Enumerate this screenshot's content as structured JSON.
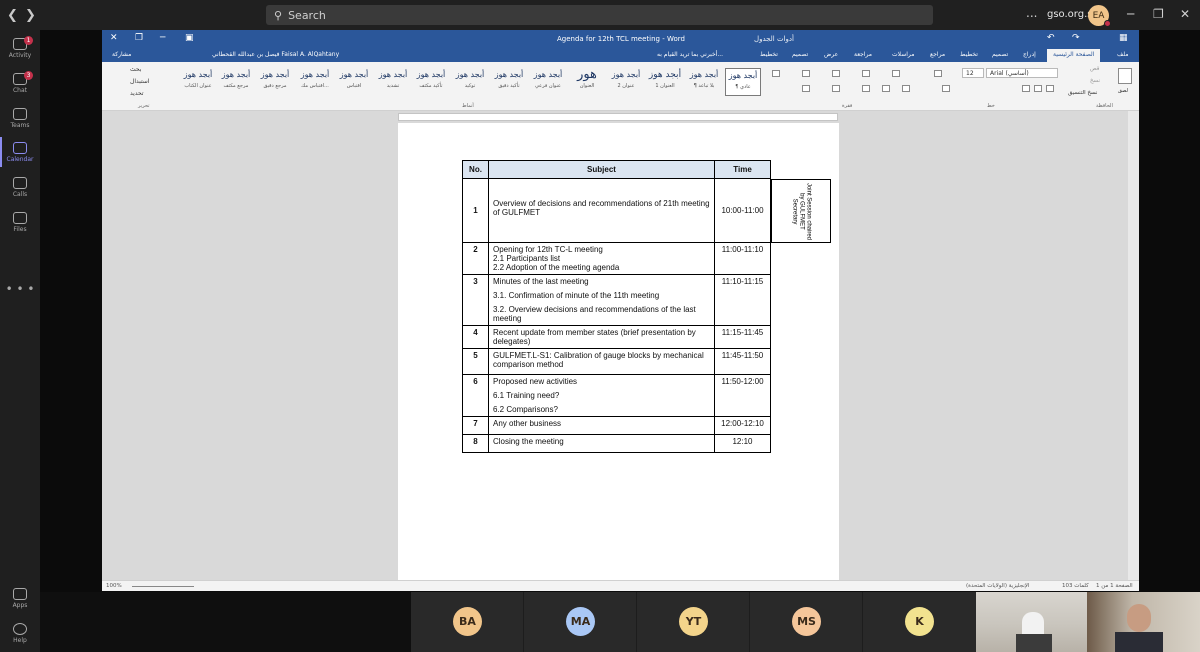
{
  "teams": {
    "search_placeholder": "Search",
    "org": "gso.org.sa",
    "user_initials": "EA",
    "rail": [
      {
        "label": "Activity",
        "badge": "1"
      },
      {
        "label": "Chat",
        "badge": "3"
      },
      {
        "label": "Teams",
        "badge": ""
      },
      {
        "label": "Calendar",
        "badge": ""
      },
      {
        "label": "Calls",
        "badge": ""
      },
      {
        "label": "Files",
        "badge": ""
      },
      {
        "label": "Apps",
        "badge": ""
      },
      {
        "label": "Help",
        "badge": ""
      }
    ],
    "more": "..."
  },
  "word": {
    "title": "Agenda for 12th TCL meeting - Word",
    "table_tools": "أدوات الجدول",
    "tell_me": "أخبرني بما تريد القيام به...",
    "user": "فيصل بن عبدالله القحطاني Faisal A. AlQahtany",
    "share": "مشاركة",
    "tabs": [
      "ملف",
      "الصفحة الرئيسية",
      "إدراج",
      "تصميم",
      "تخطيط",
      "مراجع",
      "مراسلات",
      "مراجعة",
      "عرض",
      "تصميم",
      "تخطيط"
    ],
    "font_name": "Arial (أساسي)",
    "font_size": "12",
    "styles": [
      {
        "preview": "أبجد هوز",
        "name": "¶ عادي"
      },
      {
        "preview": "أبجد هوز",
        "name": "¶ بلا تباعد"
      },
      {
        "preview": "أبجد هوز",
        "name": "العنوان 1"
      },
      {
        "preview": "أبجد هوز",
        "name": "عنوان 2"
      },
      {
        "preview": "هور",
        "name": "العنوان"
      },
      {
        "preview": "أبجد هوز",
        "name": "عنوان فرعي"
      },
      {
        "preview": "أبجد هوز",
        "name": "تأكيد دقيق"
      },
      {
        "preview": "أبجد هوز",
        "name": "توكيد"
      },
      {
        "preview": "أبجد هوز",
        "name": "تأكيد مكثف"
      },
      {
        "preview": "أبجد هوز",
        "name": "تشديد"
      },
      {
        "preview": "أبجد هوز",
        "name": "اقتباس"
      },
      {
        "preview": "أبجد هوز",
        "name": "اقتباس مك..."
      },
      {
        "preview": "أبجد هوز",
        "name": "مرجع دقيق"
      },
      {
        "preview": "أبجد هوز",
        "name": "مرجع مكثف"
      },
      {
        "preview": "أبجد هوز",
        "name": "عنوان الكتاب"
      }
    ],
    "group_labels": {
      "clipboard": "الحافظة",
      "font": "خط",
      "paragraph": "فقرة",
      "styles": "أنماط",
      "editing": "تحرير"
    },
    "clipboard": {
      "paste": "لصق",
      "cut": "قص",
      "copy": "نسخ",
      "format_painter": "نسخ التنسيق"
    },
    "editing": {
      "find": "بحث",
      "replace": "استبدال",
      "select": "تحديد"
    },
    "status": {
      "page": "الصفحة 1 من 1",
      "words": "103 كلمات",
      "language": "الإنجليزية (الولايات المتحدة)",
      "zoom": "100%"
    }
  },
  "agenda": {
    "headers": {
      "no": "No.",
      "subject": "Subject",
      "time": "Time"
    },
    "rows": [
      {
        "no": "1",
        "subject": [
          "Overview of decisions and recommendations of 21th meeting of GULFMET"
        ],
        "time": "10:00-11:00"
      },
      {
        "no": "2",
        "subject": [
          "Opening for 12th TC-L meeting",
          "2.1  Participants list",
          "2.2  Adoption of the meeting agenda"
        ],
        "time": "11:00-11:10"
      },
      {
        "no": "3",
        "subject": [
          "Minutes of the last meeting",
          "3.1. Confirmation of minute of the 11th meeting",
          "3.2. Overview decisions and recommendations of the last meeting"
        ],
        "time": "11:10-11:15"
      },
      {
        "no": "4",
        "subject": [
          "Recent update from member states (brief presentation by delegates)"
        ],
        "time": "11:15-11:45"
      },
      {
        "no": "5",
        "subject": [
          "GULFMET.L-S1: Calibration of gauge blocks by mechanical comparison method"
        ],
        "time": "11:45-11:50"
      },
      {
        "no": "6",
        "subject": [
          "Proposed new activities",
          "6.1 Training need?",
          "6.2 Comparisons?"
        ],
        "time": "11:50-12:00"
      },
      {
        "no": "7",
        "subject": [
          "Any other business"
        ],
        "time": "12:00-12:10"
      },
      {
        "no": "8",
        "subject": [
          "Closing the meeting"
        ],
        "time": "12:10"
      }
    ],
    "side_note": "Joint Session chaired by GULFMET Secretary"
  },
  "participants": [
    {
      "initials": "BA",
      "color": "#f1c58a"
    },
    {
      "initials": "MA",
      "color": "#a9c7f5"
    },
    {
      "initials": "YT",
      "color": "#f3d48b"
    },
    {
      "initials": "MS",
      "color": "#f5c69a"
    },
    {
      "initials": "K",
      "color": "#f2e28f"
    }
  ]
}
